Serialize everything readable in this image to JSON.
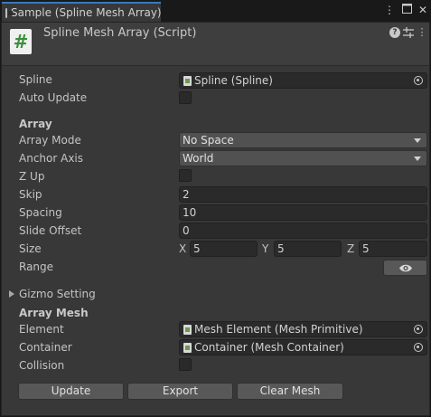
{
  "window": {
    "tab_title": "Sample (Spline Mesh Array)",
    "menu_icon": "kebab-menu-icon",
    "maximize_icon": "maximize-icon",
    "close_icon": "close-icon"
  },
  "header": {
    "script_icon": "#",
    "title": "Spline Mesh Array (Script)",
    "help_icon": "help-icon",
    "presets_icon": "presets-icon",
    "more_icon": "more-icon"
  },
  "fields": {
    "spline": {
      "label": "Spline",
      "value": "Spline (Spline)"
    },
    "auto_update": {
      "label": "Auto Update",
      "checked": false
    }
  },
  "array": {
    "section": "Array",
    "array_mode": {
      "label": "Array Mode",
      "value": "No Space"
    },
    "anchor_axis": {
      "label": "Anchor Axis",
      "value": "World"
    },
    "z_up": {
      "label": "Z Up",
      "checked": false
    },
    "skip": {
      "label": "Skip",
      "value": "2"
    },
    "spacing": {
      "label": "Spacing",
      "value": "10"
    },
    "slide_offset": {
      "label": "Slide Offset",
      "value": "0"
    },
    "size": {
      "label": "Size",
      "x_label": "X",
      "x": "5",
      "y_label": "Y",
      "y": "5",
      "z_label": "Z",
      "z": "5"
    },
    "range": {
      "label": "Range",
      "button_icon": "eye-icon"
    }
  },
  "gizmo": {
    "label": "Gizmo Setting",
    "expanded": false
  },
  "array_mesh": {
    "section": "Array Mesh",
    "element": {
      "label": "Element",
      "value": "Mesh Element (Mesh Primitive)"
    },
    "container": {
      "label": "Container",
      "value": "Container (Mesh Container)"
    },
    "collision": {
      "label": "Collision",
      "checked": false
    }
  },
  "buttons": {
    "update": "Update",
    "export": "Export",
    "clear_mesh": "Clear Mesh"
  },
  "colors": {
    "background": "#383838",
    "tab_accent": "#3a79bb",
    "field": "#2a2a2a",
    "dropdown": "#515151",
    "button": "#585858"
  }
}
